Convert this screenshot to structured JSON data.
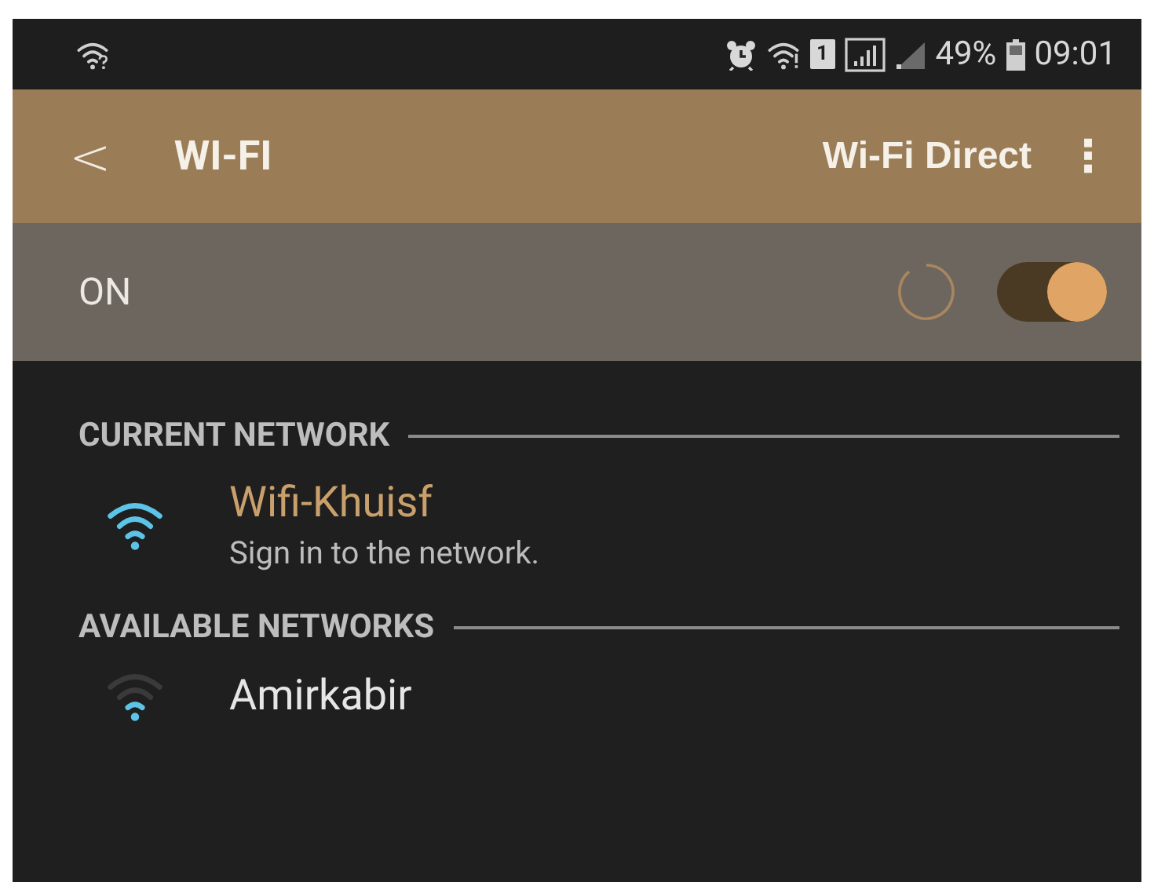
{
  "status_bar": {
    "sim_slot": "1",
    "battery": "49%",
    "time": "09:01"
  },
  "header": {
    "back": "<",
    "title": "WI-FI",
    "action": "Wi-Fi Direct",
    "menu": "⋮"
  },
  "master_switch": {
    "label": "ON",
    "on": true,
    "busy": true
  },
  "sections": [
    {
      "title": "CURRENT NETWORK",
      "networks": [
        {
          "name": "Wifi-Khuisf",
          "status": "Sign in to the network.",
          "current": true,
          "kind": "full"
        }
      ]
    },
    {
      "title": "AVAILABLE NETWORKS",
      "networks": [
        {
          "name": "Amirkabir",
          "current": false,
          "kind": "weak"
        }
      ]
    }
  ]
}
